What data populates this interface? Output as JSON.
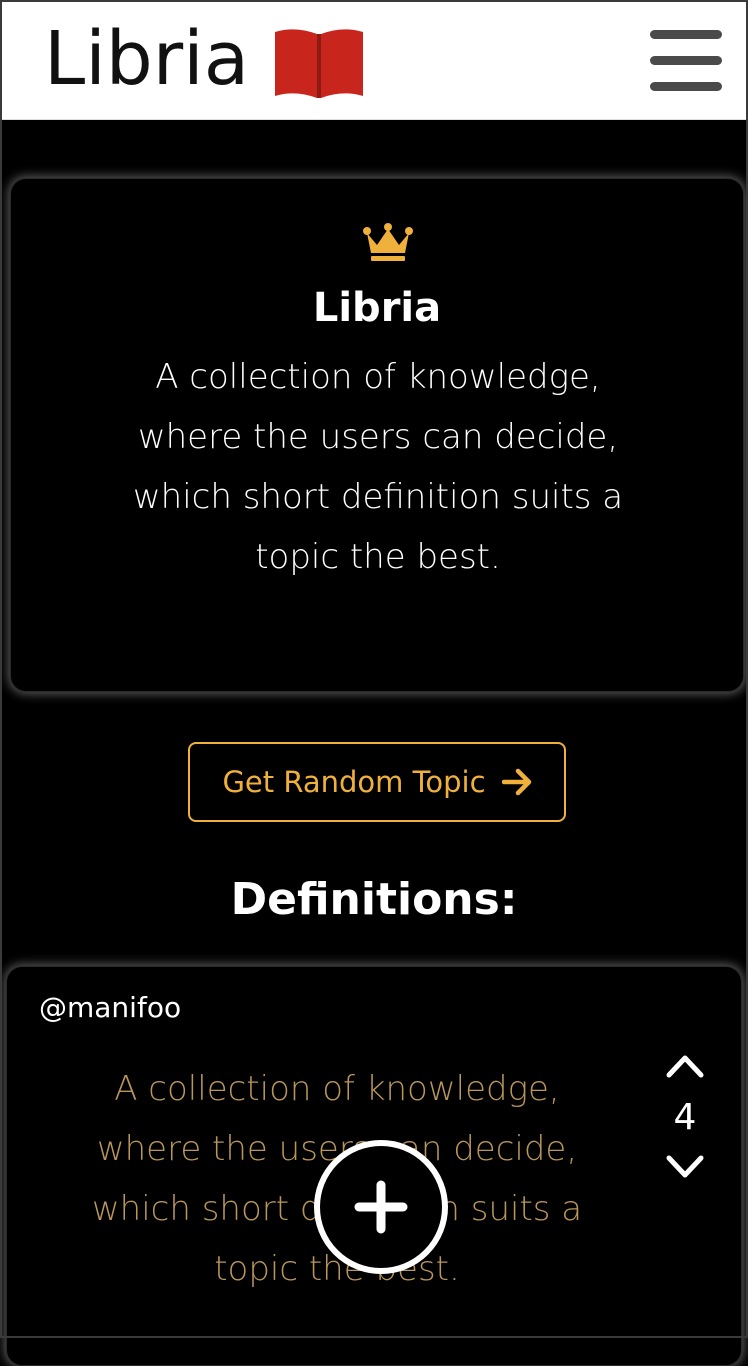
{
  "header": {
    "brand_name": "Libria",
    "icons": {
      "logo": "open-book-icon",
      "menu": "hamburger-menu-icon"
    },
    "colors": {
      "book": "#c8261d",
      "menu": "#4a4a4a"
    }
  },
  "hero": {
    "icon": "crown-icon",
    "title": "Libria",
    "description": "A collection of knowledge, where the users can decide, which short definition suits a topic the best."
  },
  "random_button": {
    "label": "Get Random Topic",
    "icon": "arrow-right-icon",
    "color": "#f0b13c"
  },
  "definitions_heading": "Definitions:",
  "definitions": [
    {
      "author": "@manifoo",
      "text": "A collection of knowledge, where the users can decide, which short definition suits a topic the best.",
      "votes": "4",
      "text_color": "#b9965a"
    }
  ],
  "fab": {
    "icon": "plus-icon"
  }
}
